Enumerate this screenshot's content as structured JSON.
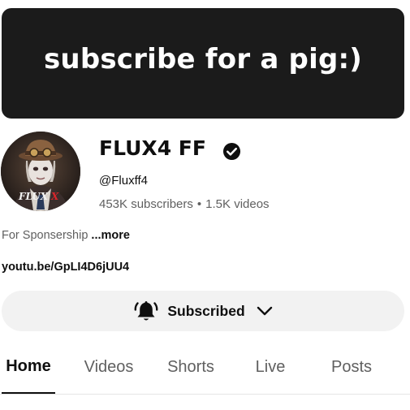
{
  "banner": {
    "text": "subscribe for a pig:)"
  },
  "channel": {
    "name": "FLUX4 FF",
    "handle": "@Fluxff4",
    "subscribers": "453K subscribers",
    "separator": "•",
    "videos": "1.5K videos",
    "avatar_text": "FLUX",
    "verified_icon": "verified-check-icon"
  },
  "description": {
    "text": "For Sponsership ",
    "more_label": "...more"
  },
  "link": {
    "text": "youtu.be/GpLI4D6jUU4"
  },
  "subscribe": {
    "label": "Subscribed",
    "bell_icon": "bell-icon",
    "chevron_icon": "chevron-down-icon"
  },
  "tabs": [
    {
      "label": "Home",
      "active": true
    },
    {
      "label": "Videos",
      "active": false
    },
    {
      "label": "Shorts",
      "active": false
    },
    {
      "label": "Live",
      "active": false
    },
    {
      "label": "Posts",
      "active": false
    }
  ],
  "colors": {
    "banner_bg": "#1b1b1b",
    "button_bg": "#f2f2f2",
    "secondary_text": "#606060",
    "accent_red": "#d7262b"
  }
}
